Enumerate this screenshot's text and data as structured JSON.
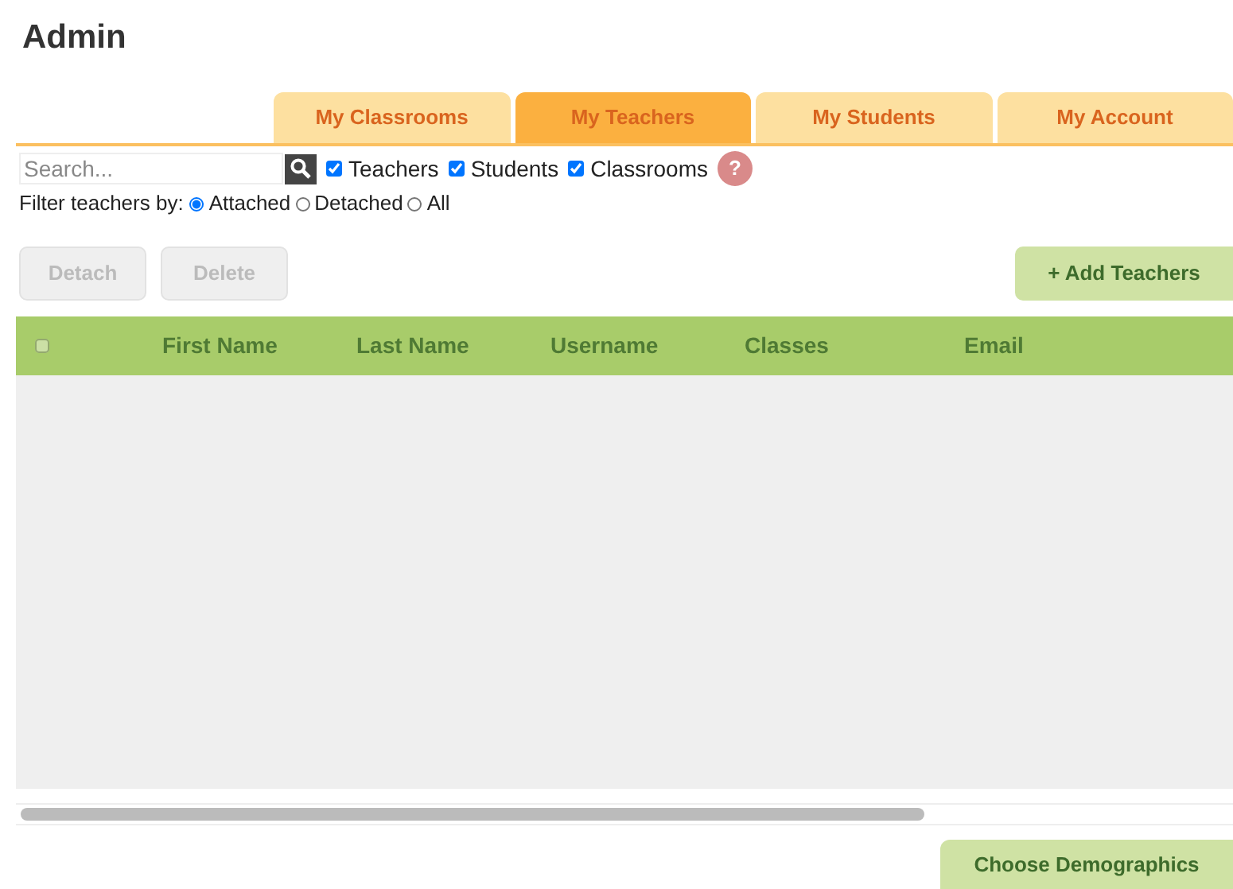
{
  "page_title": "Admin",
  "tabs": [
    {
      "label": "My Classrooms",
      "selected": false
    },
    {
      "label": "My Teachers",
      "selected": true
    },
    {
      "label": "My Students",
      "selected": false
    },
    {
      "label": "My Account",
      "selected": false
    }
  ],
  "search": {
    "placeholder": "Search..."
  },
  "scope_checkboxes": [
    {
      "label": "Teachers",
      "checked": true
    },
    {
      "label": "Students",
      "checked": true
    },
    {
      "label": "Classrooms",
      "checked": true
    }
  ],
  "help": "?",
  "filter": {
    "label": "Filter teachers by:",
    "options": [
      {
        "label": "Attached",
        "selected": true
      },
      {
        "label": "Detached",
        "selected": false
      },
      {
        "label": "All",
        "selected": false
      }
    ]
  },
  "actions": [
    {
      "label": "Detach",
      "disabled": true
    },
    {
      "label": "Delete",
      "disabled": true
    }
  ],
  "add_button": "+ Add Teachers",
  "table": {
    "select_all_checked": false,
    "columns": [
      "First Name",
      "Last Name",
      "Username",
      "Classes",
      "Email"
    ]
  },
  "footer_button": "Choose Demographics"
}
